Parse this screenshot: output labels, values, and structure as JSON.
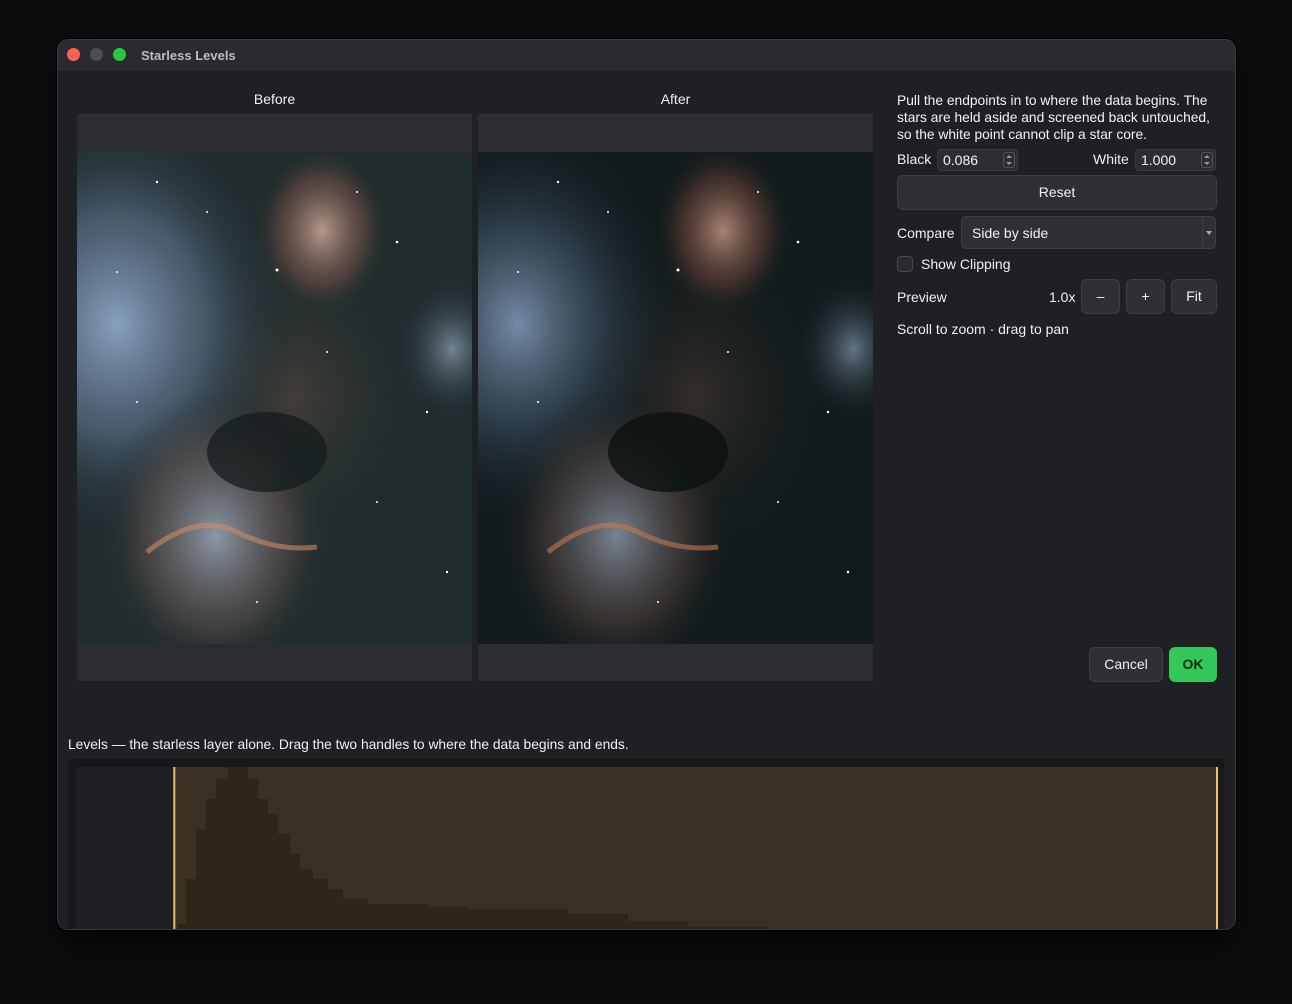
{
  "window": {
    "title": "Starless Levels"
  },
  "panes": {
    "before_label": "Before",
    "after_label": "After"
  },
  "side": {
    "description": "Pull the endpoints in to where the data begins. The stars are held aside and screened back untouched, so the white point cannot clip a star core.",
    "black_label": "Black",
    "black_value": "0.086",
    "white_label": "White",
    "white_value": "1.000",
    "reset_label": "Reset",
    "compare_label": "Compare",
    "compare_value": "Side by side",
    "show_clipping_label": "Show Clipping",
    "show_clipping_checked": false,
    "preview_label": "Preview",
    "zoom_value": "1.0x",
    "zoom_out_label": "–",
    "zoom_in_label": "+",
    "fit_label": "Fit",
    "hint": "Scroll to zoom · drag to pan",
    "cancel_label": "Cancel",
    "ok_label": "OK"
  },
  "levels": {
    "label": "Levels — the starless layer alone. Drag the two handles to where the data begins and ends.",
    "black_point": 0.086,
    "white_point": 1.0,
    "histogram_color": "#3a3023",
    "handle_color": "#f2c063"
  },
  "colors": {
    "ok": "#34c759",
    "close": "#fe5f57",
    "maximize": "#28c840"
  }
}
